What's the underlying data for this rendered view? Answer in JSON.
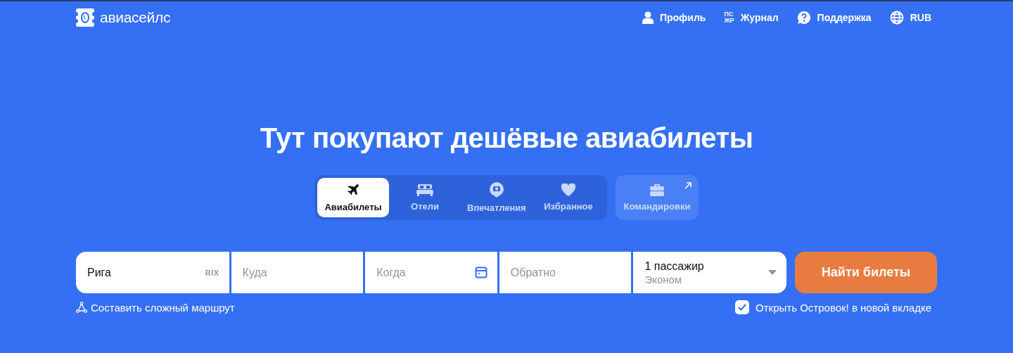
{
  "header": {
    "logo_text": "авиасейлс",
    "nav": [
      {
        "kind": "profile",
        "label": "Профиль"
      },
      {
        "kind": "journal",
        "label": "Журнал",
        "glyph_lines": [
          "ПС",
          "ЖР"
        ]
      },
      {
        "kind": "support",
        "label": "Поддержка"
      },
      {
        "kind": "currency",
        "label": "RUB"
      }
    ]
  },
  "title": "Тут покупают дешёвые авиабилеты",
  "tabs": [
    {
      "kind": "plane",
      "label": "Авиабилеты",
      "selected": true
    },
    {
      "kind": "bed",
      "label": "Отели",
      "selected": false
    },
    {
      "kind": "pin",
      "label": "Впечатления",
      "selected": false
    },
    {
      "kind": "heart",
      "label": "Избранное",
      "selected": false
    }
  ],
  "external_tab": {
    "kind": "briefcase",
    "label": "Командировки"
  },
  "search_form": {
    "origin": {
      "value": "Рига",
      "code": "RIX"
    },
    "destination": {
      "placeholder": "Куда"
    },
    "depart": {
      "placeholder": "Когда"
    },
    "return": {
      "placeholder": "Обратно"
    },
    "passengers": {
      "value": "1 пассажир",
      "class": "Эконом"
    },
    "submit": "Найти билеты"
  },
  "complex_route_link": "Составить сложный маршрут",
  "open_ostrovok": {
    "label": "Открыть Островок! в новой вкладке",
    "checked": true
  }
}
